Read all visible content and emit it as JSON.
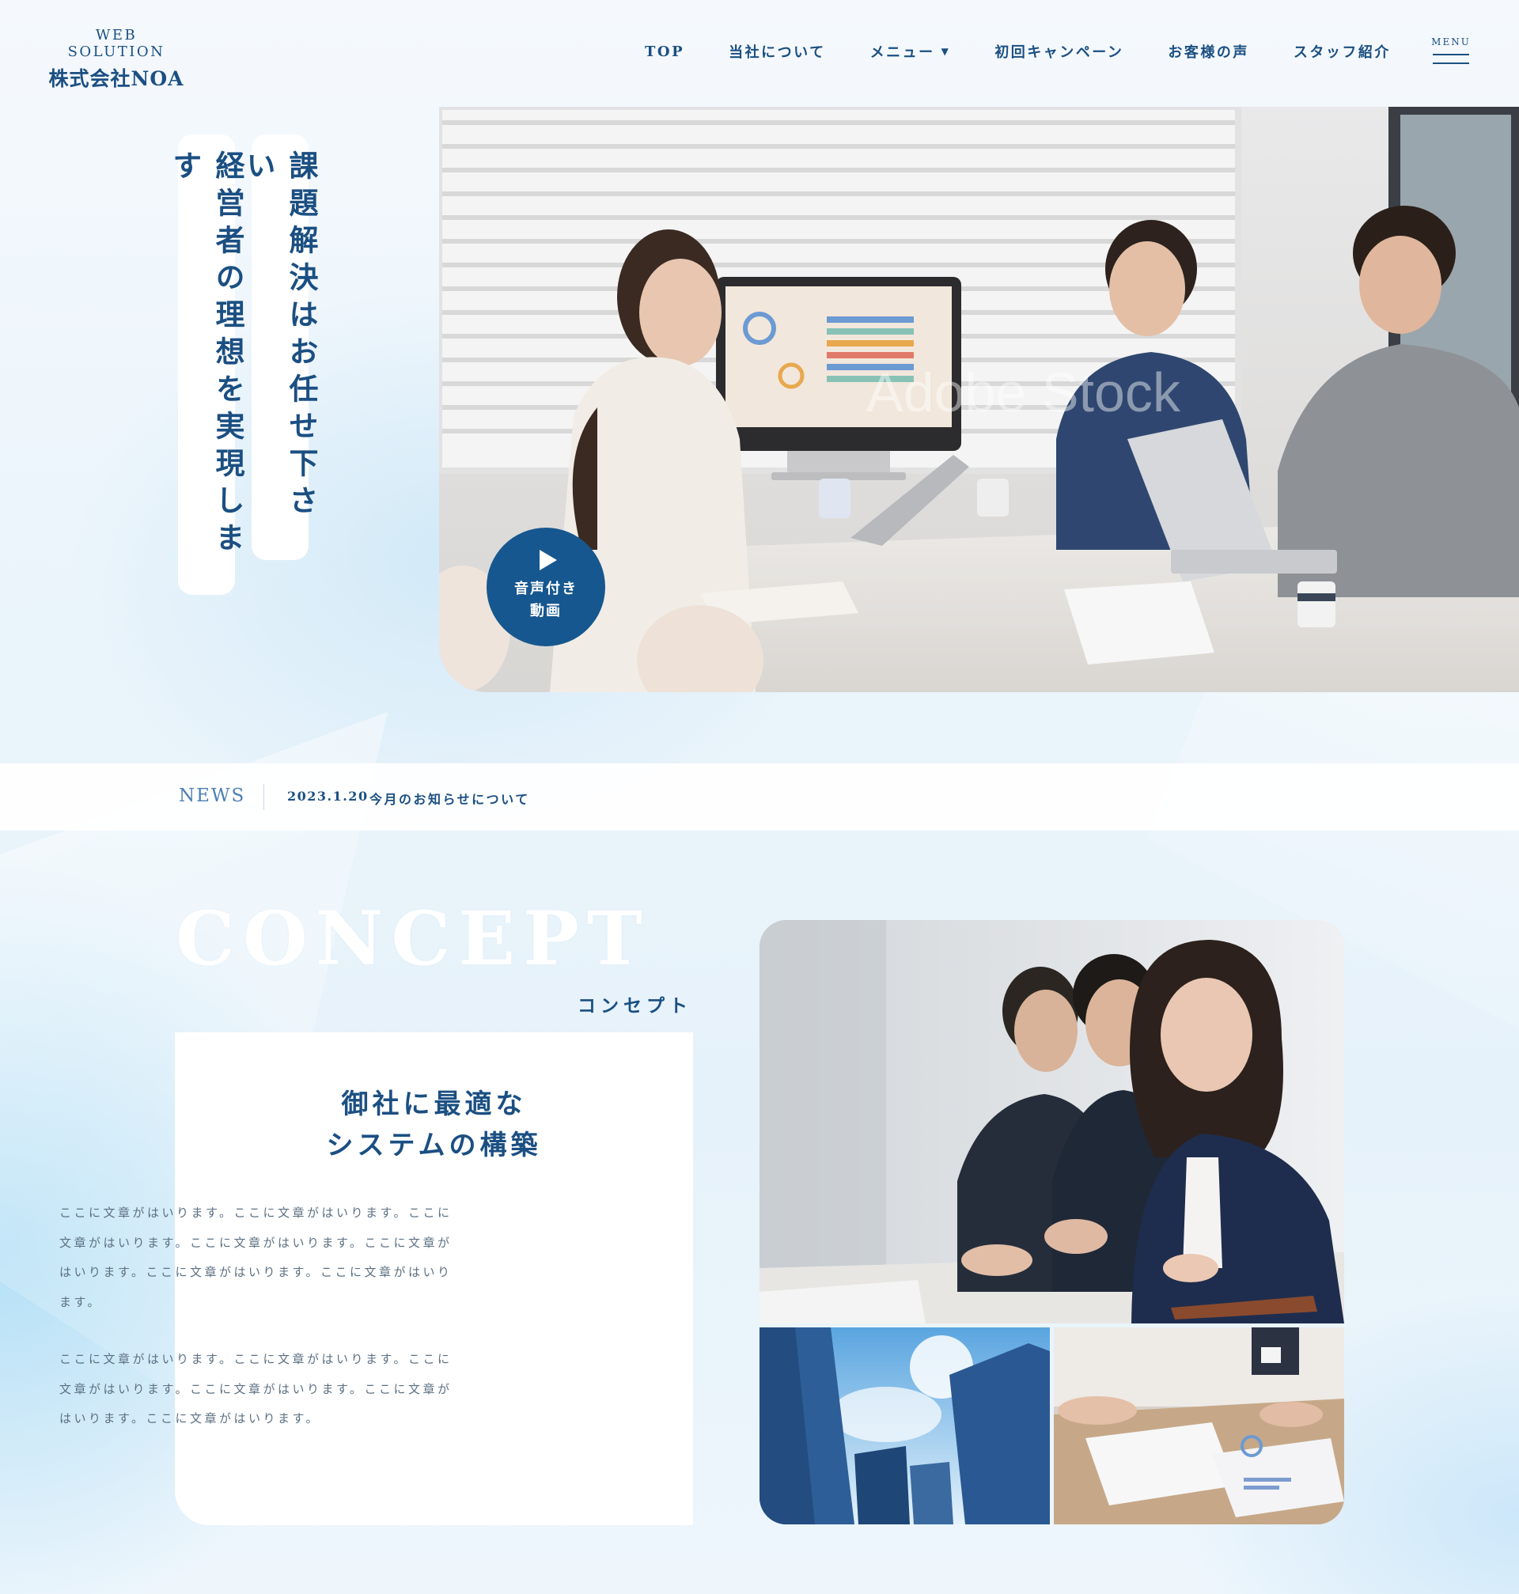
{
  "brand": {
    "sub": "WEB SOLUTION",
    "name": "株式会社NOA"
  },
  "nav": {
    "items": [
      {
        "label": "TOP"
      },
      {
        "label": "当社について"
      },
      {
        "label": "メニュー",
        "caret": "▼"
      },
      {
        "label": "初回キャンペーン"
      },
      {
        "label": "お客様の声"
      },
      {
        "label": "スタッフ紹介"
      }
    ],
    "menu_label": "MENU"
  },
  "hero": {
    "copy_1": "課題解決はお任せ下さい",
    "copy_2": "経営者の理想を実現します",
    "play_line1": "音声付き",
    "play_line2": "動画",
    "watermark": "Adobe Stock"
  },
  "news": {
    "label": "NEWS",
    "date": "2023.1.20",
    "title": "今月のお知らせについて"
  },
  "concept": {
    "title_en": "CONCEPT",
    "title_ja": "コンセプト",
    "heading_line1": "御社に最適な",
    "heading_line2": "システムの構築",
    "paragraph_1": "ここに文章がはいります。ここに文章がはいります。ここに文章がはいります。ここに文章がはいります。ここに文章がはいります。ここに文章がはいります。ここに文章がはいります。",
    "paragraph_2": "ここに文章がはいります。ここに文章がはいります。ここに文章がはいります。ここに文章がはいります。ここに文章がはいります。ここに文章がはいります。"
  },
  "colors": {
    "primary": "#1b4f82",
    "play_button": "#16578f",
    "accent_light": "#4d7eb1"
  },
  "icons": {
    "play": "play-icon",
    "menu": "hamburger-icon",
    "caret": "caret-down-icon"
  }
}
